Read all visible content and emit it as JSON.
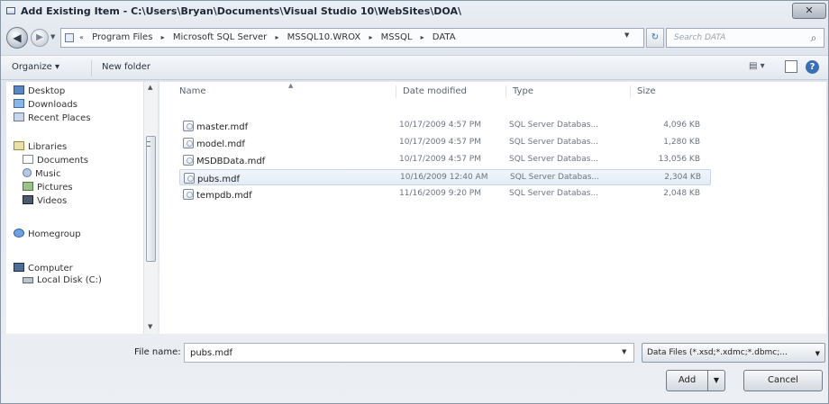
{
  "window": {
    "title": "Add Existing Item - C:\\Users\\Bryan\\Documents\\Visual Studio 10\\WebSites\\DOA\\",
    "close_label": "✕"
  },
  "address": {
    "segments": [
      "Program Files",
      "Microsoft SQL Server",
      "MSSQL10.WROX",
      "MSSQL",
      "DATA"
    ],
    "search_placeholder": "Search DATA"
  },
  "toolbar": {
    "organize_label": "Organize ▾",
    "new_folder_label": "New folder"
  },
  "nav": {
    "favorites": [
      "Desktop",
      "Downloads",
      "Recent Places"
    ],
    "libraries_label": "Libraries",
    "libraries": [
      "Documents",
      "Music",
      "Pictures",
      "Videos"
    ],
    "homegroup_label": "Homegroup",
    "computer_label": "Computer",
    "computer_items": [
      "Local Disk (C:)"
    ]
  },
  "columns": {
    "name": "Name",
    "date": "Date modified",
    "type": "Type",
    "size": "Size"
  },
  "files": [
    {
      "name": "master.mdf",
      "date": "10/17/2009 4:57 PM",
      "type": "SQL Server Databas...",
      "size": "4,096 KB"
    },
    {
      "name": "model.mdf",
      "date": "10/17/2009 4:57 PM",
      "type": "SQL Server Databas...",
      "size": "1,280 KB"
    },
    {
      "name": "MSDBData.mdf",
      "date": "10/17/2009 4:57 PM",
      "type": "SQL Server Databas...",
      "size": "13,056 KB"
    },
    {
      "name": "pubs.mdf",
      "date": "10/16/2009 12:40 AM",
      "type": "SQL Server Databas...",
      "size": "2,304 KB"
    },
    {
      "name": "tempdb.mdf",
      "date": "11/16/2009 9:20 PM",
      "type": "SQL Server Databas...",
      "size": "2,048 KB"
    }
  ],
  "bottom": {
    "file_name_label": "File name:",
    "file_name_value": "pubs.mdf",
    "filter_value": "Data Files (*.xsd;*.xdmc;*.dbmc;...",
    "add_label": "Add",
    "cancel_label": "Cancel"
  }
}
